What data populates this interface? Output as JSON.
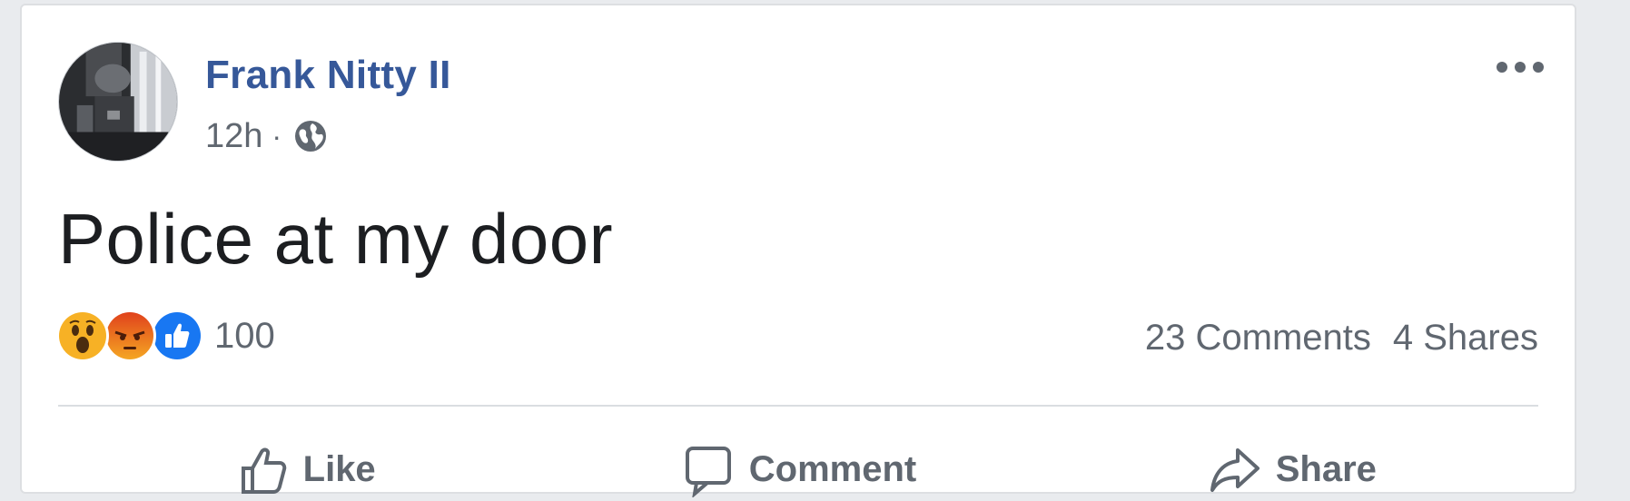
{
  "post": {
    "author": "Frank Nitty II",
    "time": "12h",
    "separator": "·",
    "privacy_icon": "globe-icon",
    "text": "Police at my door",
    "more_icon": "more-options-icon"
  },
  "reactions": {
    "icons": [
      "wow-reaction-icon",
      "angry-reaction-icon",
      "like-reaction-icon"
    ],
    "count": "100"
  },
  "stats": {
    "comments": "23 Comments",
    "shares": "4 Shares"
  },
  "actions": {
    "like_label": "Like",
    "comment_label": "Comment",
    "share_label": "Share"
  },
  "colors": {
    "author": "#365899",
    "secondary_text": "#606770",
    "background": "#e9ebee",
    "like_blue": "#1877f2",
    "wow_yellow": "#f7b125",
    "angry_orange": "#e9710f"
  }
}
